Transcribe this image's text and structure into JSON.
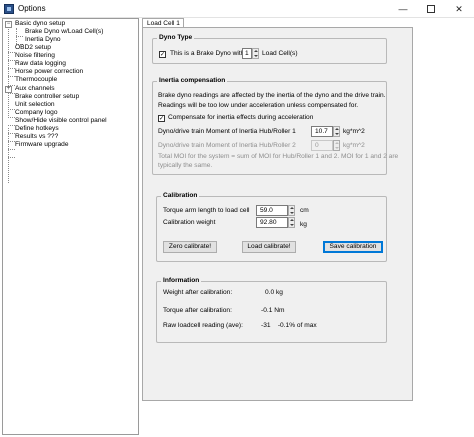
{
  "window": {
    "title": "Options",
    "minimize": "—",
    "close": "✕"
  },
  "tree": {
    "items": [
      {
        "label": "Basic dyno setup",
        "expander": "−"
      },
      {
        "label": "Brake Dyno w/Load Cell(s)"
      },
      {
        "label": "Inertia Dyno"
      },
      {
        "label": "OBD2 setup"
      },
      {
        "label": "Noise filtering"
      },
      {
        "label": "Raw data logging"
      },
      {
        "label": "Horse power correction"
      },
      {
        "label": "Thermocouple"
      },
      {
        "label": "Aux channels",
        "expander": "+"
      },
      {
        "label": "Brake controller setup"
      },
      {
        "label": "Unit selection"
      },
      {
        "label": "Company logo"
      },
      {
        "label": "Show/Hide visible control panel"
      },
      {
        "label": "Define hotkeys"
      },
      {
        "label": "Results vs ???"
      },
      {
        "label": "Firmware upgrade"
      }
    ]
  },
  "tab": {
    "label": "Load Cell 1"
  },
  "dyno_type": {
    "legend": "Dyno Type",
    "checkbox_checked": true,
    "prefix": "This is a Brake Dyno with",
    "count": "1",
    "suffix": "Load Cell(s)"
  },
  "inertia": {
    "legend": "Inertia compensation",
    "desc1": "Brake dyno readings are affected by the inertia of the dyno and the drive train.",
    "desc2": "Readings will be too low under acceleration unless compensated for.",
    "compensate_label": "Compensate for inertia effects during acceleration",
    "compensate_checked": true,
    "moi1_label": "Dyno/drive train Moment of Inertia Hub/Roller 1",
    "moi1_value": "10.7",
    "moi1_unit": "kg*m^2",
    "moi2_label": "Dyno/drive train Moment of Inertia Hub/Roller 2",
    "moi2_value": "0",
    "moi2_unit": "kg*m^2",
    "total1": "Total MOI for the system = sum of MOI for Hub/Roller 1 and 2. MOI for 1 and 2 are",
    "total2": "typically the same."
  },
  "calibration": {
    "legend": "Calibration",
    "arm_label": "Torque arm length to load cell",
    "arm_value": "59.0",
    "arm_unit": "cm",
    "weight_label": "Calibration weight",
    "weight_value": "92.80",
    "weight_unit": "kg",
    "zero_button": "Zero calibrate!",
    "load_button": "Load calibrate!",
    "save_button": "Save calibration"
  },
  "information": {
    "legend": "Information",
    "rows": [
      {
        "label": "Weight after calibration:",
        "value": "0.0 kg"
      },
      {
        "label": "Torque after calibration:",
        "value": "-0.1 Nm"
      },
      {
        "label": "Raw loadcell reading (ave):",
        "value": "-31    -0.1% of max"
      }
    ]
  }
}
